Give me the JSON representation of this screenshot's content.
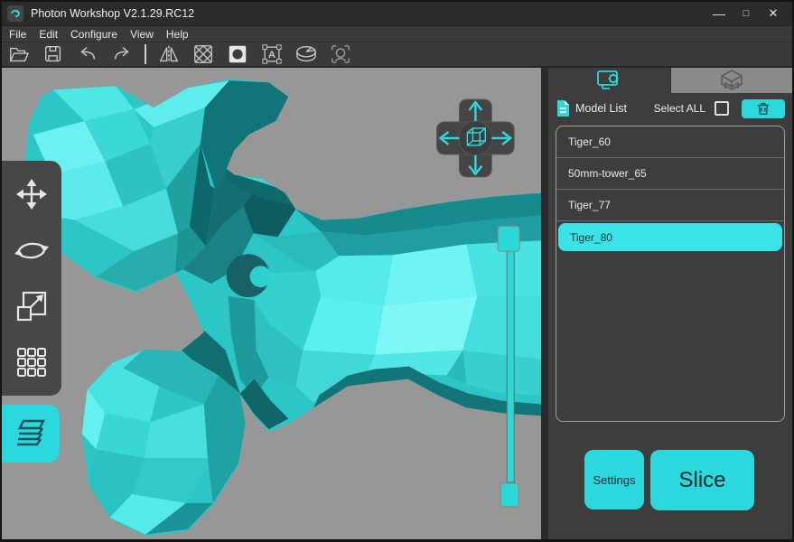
{
  "window": {
    "title": "Photon Workshop V2.1.29.RC12",
    "controls": {
      "minimize": "—",
      "maximize": "□",
      "close": "✕"
    }
  },
  "menu": {
    "items": [
      {
        "label": "File"
      },
      {
        "label": "Edit"
      },
      {
        "label": "Configure"
      },
      {
        "label": "View"
      },
      {
        "label": "Help"
      }
    ]
  },
  "toolbar": {
    "icons": [
      "open-file",
      "save-file",
      "undo",
      "redo",
      "mirror",
      "hollow",
      "punch-hole",
      "add-text",
      "split-model",
      "face-detect"
    ]
  },
  "left_tools": {
    "tools": [
      "move",
      "rotate",
      "scale",
      "clone"
    ],
    "active_tool": "layers"
  },
  "viewport": {
    "nav_pad": {
      "arrows": [
        "up",
        "down",
        "left",
        "right"
      ],
      "center": "view-cube"
    },
    "z_slider": {
      "handles": [
        "top",
        "bottom"
      ]
    }
  },
  "right_panel": {
    "tabs": [
      {
        "id": "model-list",
        "icon": "monitor-gear-icon",
        "active": true
      },
      {
        "id": "print-preview",
        "icon": "printer-box-icon",
        "active": false
      }
    ],
    "header": {
      "icon": "document-icon",
      "title": "Model List",
      "select_all_label": "Select ALL",
      "select_all_checked": false,
      "delete_icon": "trash-icon"
    },
    "model_list": {
      "items": [
        {
          "name": "Tiger_60",
          "selected": false
        },
        {
          "name": "50mm-tower_65",
          "selected": false
        },
        {
          "name": "Tiger_77",
          "selected": false
        },
        {
          "name": "Tiger_80",
          "selected": true
        }
      ]
    },
    "footer": {
      "settings_label": "Settings",
      "slice_label": "Slice"
    }
  },
  "colors": {
    "accent": "#2BD8DE",
    "selected_row": "#3BE2E8",
    "viewport_bg": "#979797",
    "panel_bg": "#3D3D3D",
    "inactive_tab_bg": "#8A8A8A",
    "titlebar_bg": "#2B2B2B",
    "menubar_bg": "#3A3A3A"
  }
}
